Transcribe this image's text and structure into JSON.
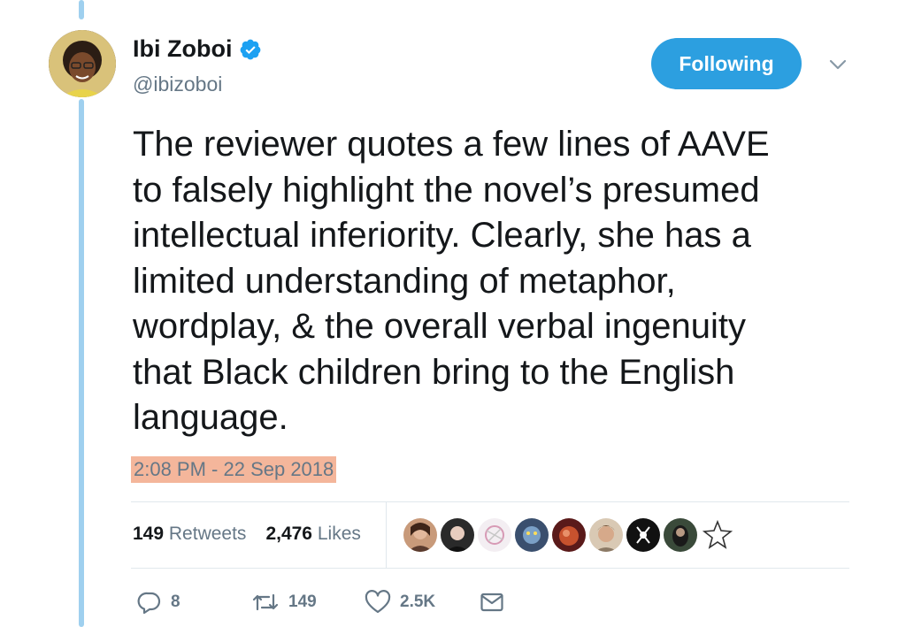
{
  "profile": {
    "name": "Ibi Zoboi",
    "handle": "@ibizoboi"
  },
  "follow_button": {
    "label": "Following"
  },
  "tweet": {
    "text_lines": [
      "The reviewer quotes a few lines of AAVE",
      "to falsely highlight the novel’s presumed",
      "intellectual inferiority. Clearly, she has a",
      "limited understanding of metaphor,",
      "wordplay, & the overall verbal ingenuity",
      "that Black children bring to the English",
      "language."
    ],
    "timestamp": "2:08 PM - 22 Sep 2018"
  },
  "stats": {
    "retweets_count": "149",
    "retweets_label": "Retweets",
    "likes_count": "2,476",
    "likes_label": "Likes"
  },
  "likers": [
    {
      "icon": "avatar-1"
    },
    {
      "icon": "avatar-2"
    },
    {
      "icon": "avatar-3"
    },
    {
      "icon": "avatar-4"
    },
    {
      "icon": "avatar-5"
    },
    {
      "icon": "avatar-6"
    },
    {
      "icon": "avatar-7"
    },
    {
      "icon": "avatar-8"
    },
    {
      "icon": "avatar-9"
    }
  ],
  "actions": {
    "reply_count": "8",
    "retweet_count": "149",
    "like_count": "2.5K"
  },
  "colors": {
    "accent": "#2c9fe0",
    "thread_line": "#9fd0ef",
    "timestamp_highlight": "#f4b69b"
  }
}
